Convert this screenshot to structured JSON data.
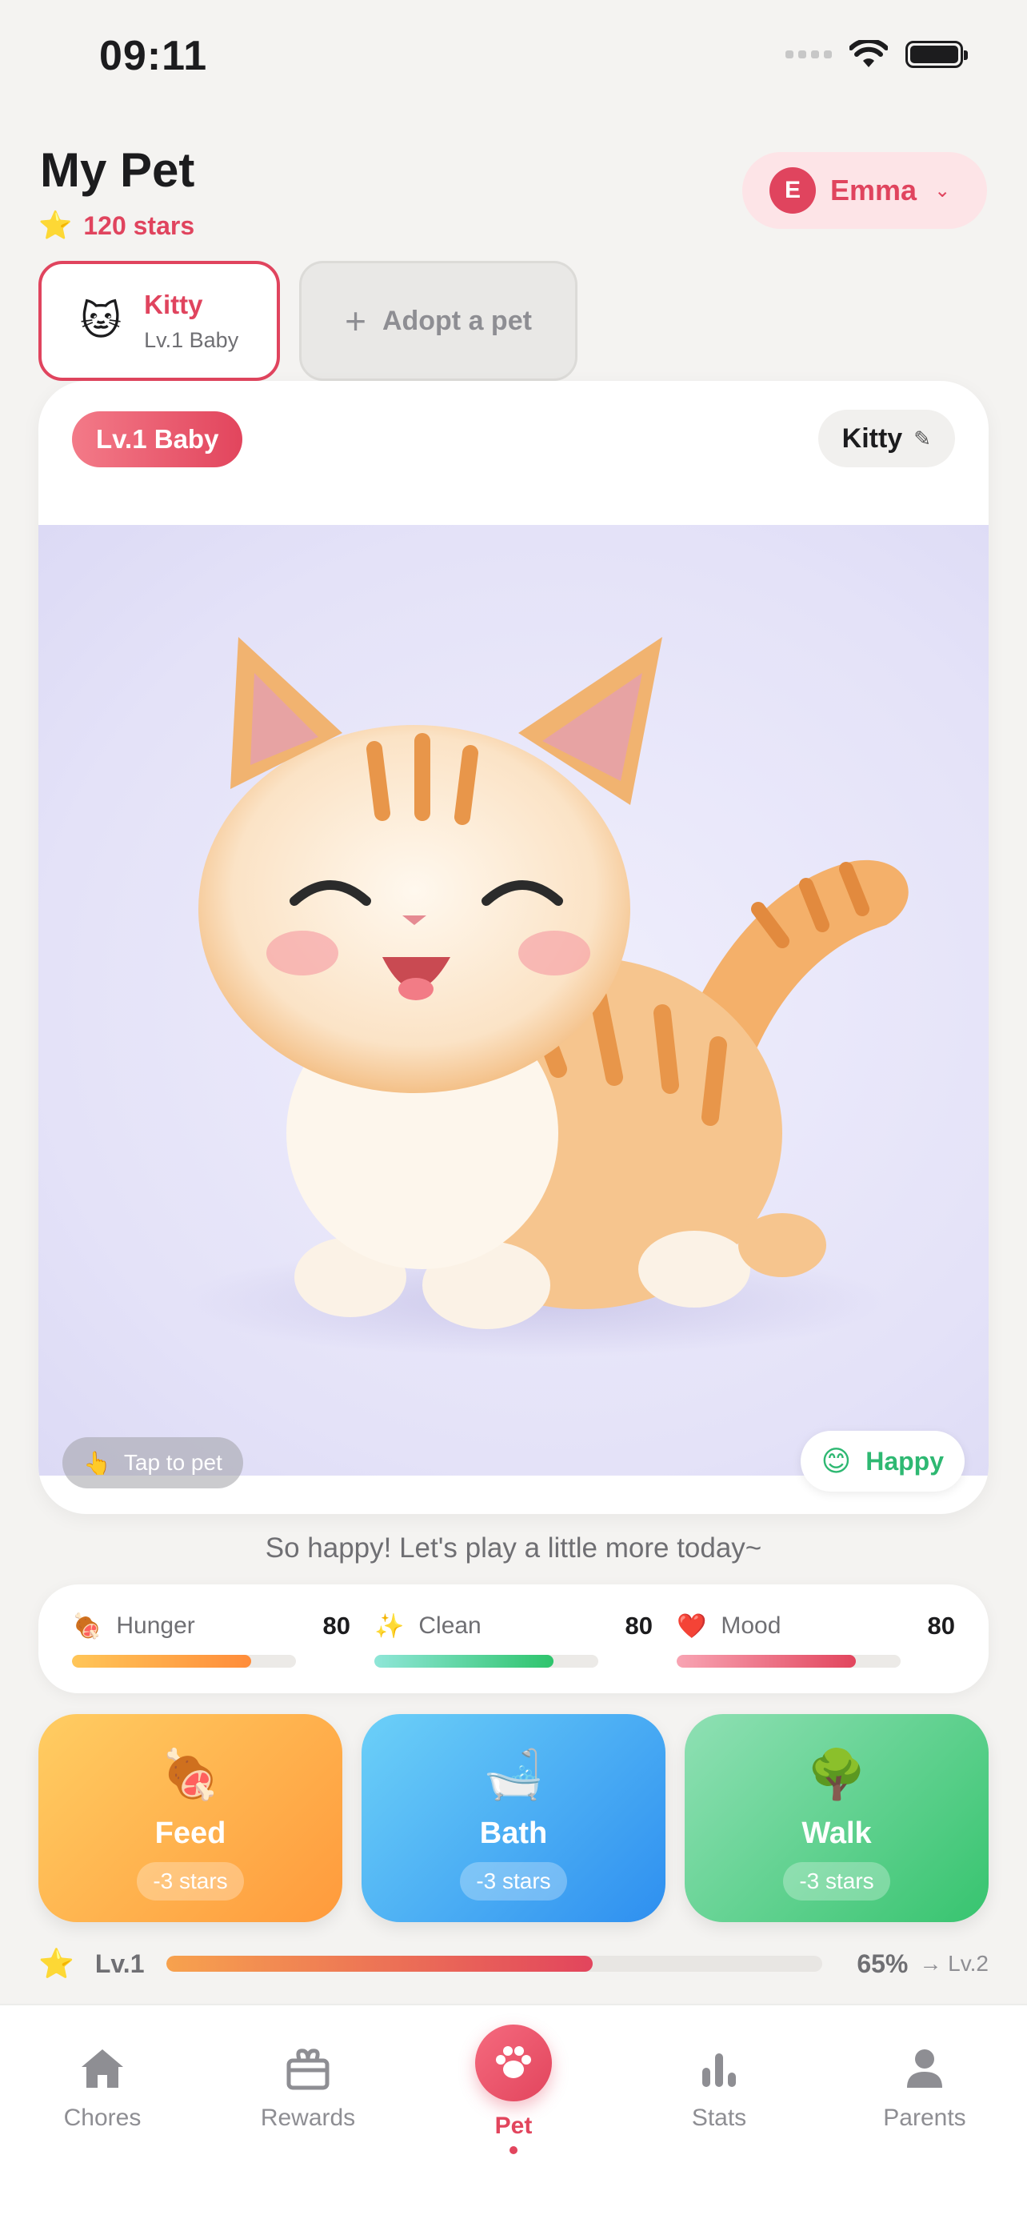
{
  "status": {
    "time": "09:11"
  },
  "header": {
    "title": "My Pet",
    "stars": "120 stars",
    "user": {
      "initial": "E",
      "name": "Emma"
    }
  },
  "pet_tabs": {
    "active": {
      "name": "Kitty",
      "level": "Lv.1 Baby",
      "emoji": "🐱"
    },
    "adopt_label": "Adopt a pet"
  },
  "pet_card": {
    "level_badge": "Lv.1 Baby",
    "pet_name": "Kitty",
    "tap_hint": "Tap to pet",
    "mood": "Happy",
    "image_desc": "smiling orange tabby kitten"
  },
  "message": "So happy! Let's play a little more today~",
  "stats": [
    {
      "label": "Hunger",
      "value": "80",
      "level": 0.8,
      "icon": "🍖",
      "color_from": "#ffc658",
      "color_to": "#ff8c3a"
    },
    {
      "label": "Clean",
      "value": "80",
      "level": 0.8,
      "icon": "✨",
      "color_from": "#8fe6d8",
      "color_to": "#2ec46c"
    },
    {
      "label": "Mood",
      "value": "80",
      "level": 0.8,
      "icon": "❤️",
      "color_from": "#f8a4b3",
      "color_to": "#e2455d"
    }
  ],
  "actions": [
    {
      "label": "Feed",
      "cost": "-3 stars",
      "icon": "🍖"
    },
    {
      "label": "Bath",
      "cost": "-3 stars",
      "icon": "🛁"
    },
    {
      "label": "Walk",
      "cost": "-3 stars",
      "icon": "🌳"
    }
  ],
  "level_progress": {
    "current": "Lv.1",
    "percent_text": "65%",
    "fraction": 0.65,
    "next": "→ Lv.2"
  },
  "tabbar": {
    "chores": "Chores",
    "rewards": "Rewards",
    "pet": "Pet",
    "stats": "Stats",
    "parents": "Parents"
  },
  "colors": {
    "accent": "#e2455d",
    "happy": "#2eb872"
  }
}
